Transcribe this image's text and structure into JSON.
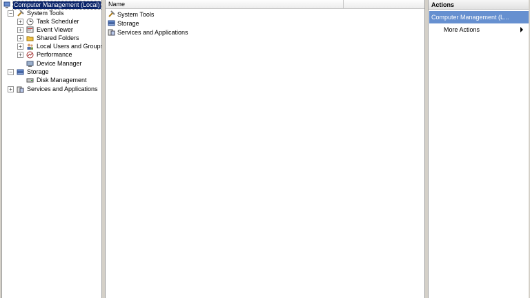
{
  "tree": {
    "root_label": "Computer Management (Local)",
    "system_tools_label": "System Tools",
    "task_scheduler_label": "Task Scheduler",
    "event_viewer_label": "Event Viewer",
    "shared_folders_label": "Shared Folders",
    "local_users_label": "Local Users and Groups",
    "performance_label": "Performance",
    "device_manager_label": "Device Manager",
    "storage_label": "Storage",
    "disk_management_label": "Disk Management",
    "services_label": "Services and Applications",
    "expand_glyph": "+",
    "collapse_glyph": "−"
  },
  "list": {
    "column_name": "Name",
    "items": [
      "System Tools",
      "Storage",
      "Services and Applications"
    ]
  },
  "actions": {
    "header": "Actions",
    "section_title": "Computer Management (L...",
    "more_actions": "More Actions"
  },
  "colors": {
    "selection": "#0a246a",
    "section_band": "#6690d0"
  }
}
